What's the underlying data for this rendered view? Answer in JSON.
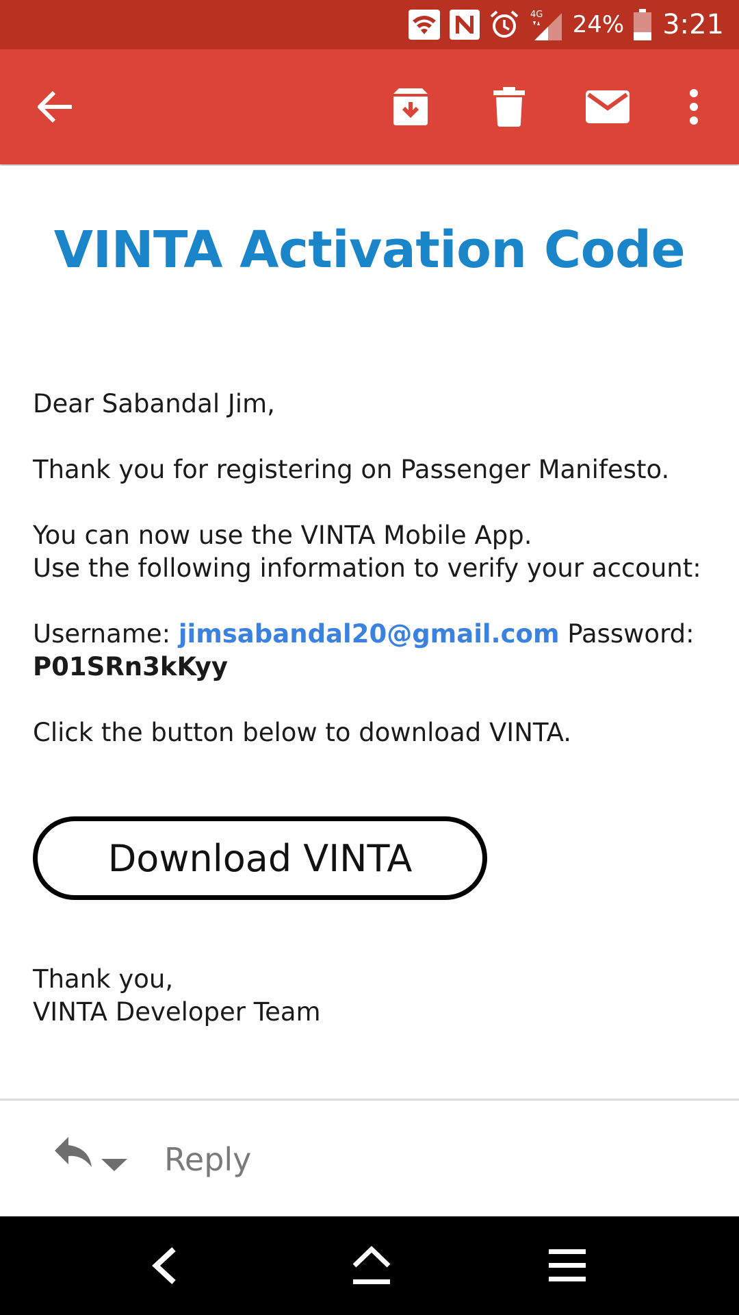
{
  "status_bar": {
    "network_type": "4G",
    "battery_percent": "24%",
    "time": "3:21",
    "icons": [
      "wifi-icon",
      "nfc-icon",
      "alarm-icon",
      "signal-icon",
      "battery-icon"
    ]
  },
  "app_bar": {
    "icons": [
      "back-arrow-icon",
      "archive-icon",
      "delete-icon",
      "mark-unread-icon",
      "more-vert-icon"
    ],
    "color": "#db4437"
  },
  "email": {
    "title": "VINTA Activation Code",
    "greeting": "Dear Sabandal Jim,",
    "thanks_line": "Thank you for registering on Passenger Manifesto.",
    "app_line": "You can now use the VINTA Mobile App.",
    "verify_line": "Use the following information to verify your account:",
    "username_label": "Username:",
    "username_value": "jimsabandal20@gmail.com",
    "password_label": "Password:",
    "password_value": "P01SRn3kKyy",
    "click_line": "Click the button below to download VINTA.",
    "download_button": "Download VINTA",
    "signoff_1": "Thank you,",
    "signoff_2": "VINTA Developer Team",
    "title_color": "#1b85c9",
    "link_color": "#3b82e0"
  },
  "reply_bar": {
    "reply_label": "Reply"
  },
  "nav_bar": {
    "icons": [
      "nav-back-icon",
      "nav-home-icon",
      "nav-menu-icon"
    ]
  }
}
